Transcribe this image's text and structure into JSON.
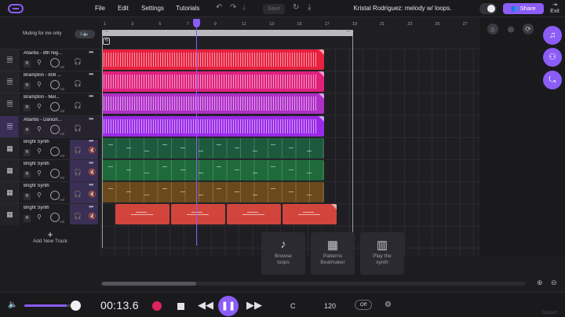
{
  "menu": {
    "file": "File",
    "edit": "Edit",
    "settings": "Settings",
    "tutorials": "Tutorials",
    "save": "Save"
  },
  "project_title": "Kristal Rodriguez: melody w/ loops.",
  "share_label": "Share",
  "exit_label": "Exit",
  "muting_label": "Muting for me only",
  "ruler_ticks": [
    "1",
    "3",
    "5",
    "7",
    "9",
    "11",
    "13",
    "15",
    "17",
    "19",
    "21",
    "23",
    "25",
    "27"
  ],
  "tracks": [
    {
      "name": "Atlantis - 8th Nig...",
      "icon": "waveform-icon",
      "type": "audio",
      "color": "#e8213f",
      "wave": true
    },
    {
      "name": "Brampton - 808 ...",
      "icon": "waveform-icon",
      "type": "audio",
      "color": "#e0207d",
      "wave": true
    },
    {
      "name": "Brampton - Mel...",
      "icon": "waveform-icon",
      "type": "audio",
      "color": "#b02fc7",
      "wave": true
    },
    {
      "name": "Atlantis - Dancin...",
      "icon": "waveform-icon",
      "type": "audio",
      "color": "#9b2ae8",
      "wave": true
    },
    {
      "name": "Bright Synth",
      "icon": "piano-icon",
      "type": "instrument",
      "color": "#1d5a3d",
      "wave": false
    },
    {
      "name": "Bright Synth",
      "icon": "piano-icon",
      "type": "instrument",
      "color": "#1f6a3a",
      "wave": false
    },
    {
      "name": "Bright Synth",
      "icon": "piano-icon",
      "type": "instrument",
      "color": "#6a4a1c",
      "wave": false
    },
    {
      "name": "Bright Synth",
      "icon": "piano-icon",
      "type": "instrument",
      "color": "#d2453c",
      "wave": false
    }
  ],
  "add_track_label": "Add New Track",
  "panels": [
    {
      "icon": "music-note-icon",
      "line1": "Browse",
      "line2": "loops"
    },
    {
      "icon": "grid-icon",
      "line1": "Patterns",
      "line2": "Beatmaker"
    },
    {
      "icon": "piano-keys-icon",
      "line1": "Play the",
      "line2": "synth"
    }
  ],
  "transport": {
    "time": "00:13.6",
    "key": "C",
    "bpm": "120",
    "metronome": "Off",
    "volume": 0.82
  },
  "support_label": "Support",
  "colors": {
    "accent": "#8b5cf6",
    "record": "#e0245e"
  }
}
